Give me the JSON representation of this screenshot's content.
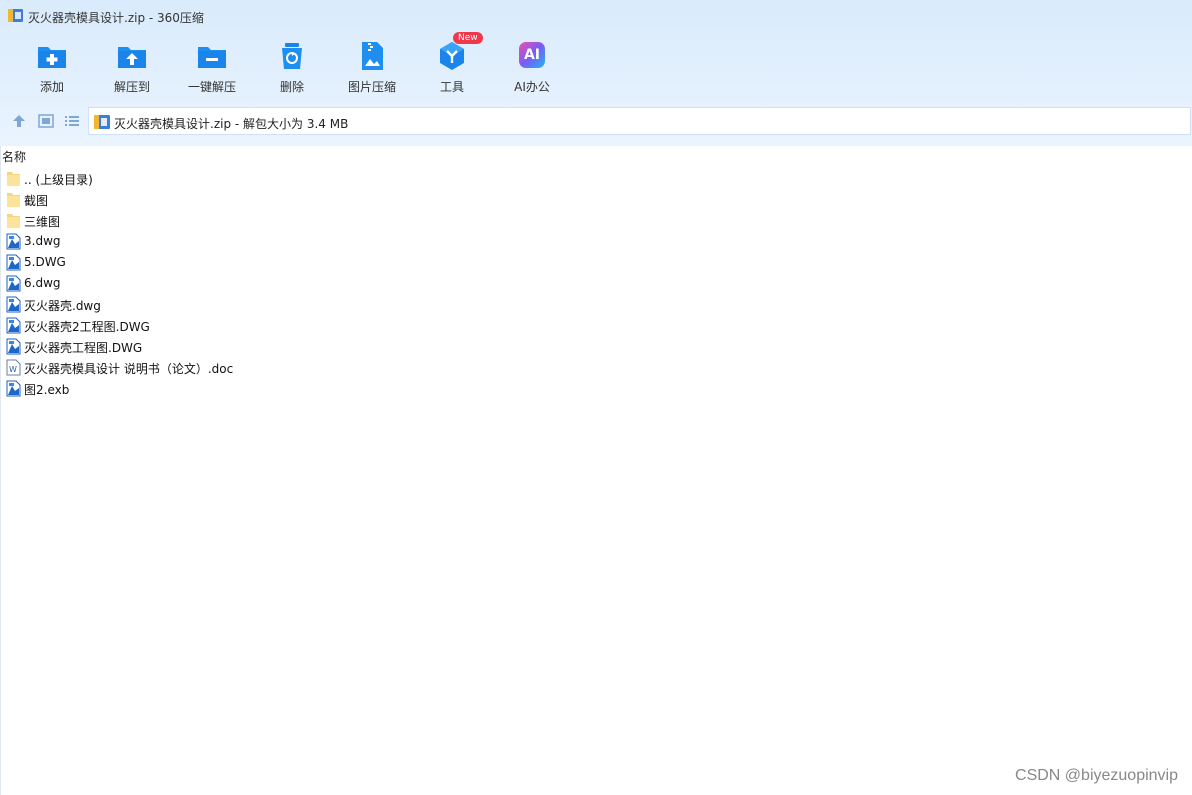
{
  "window": {
    "title": "灭火器壳模具设计.zip - 360压缩"
  },
  "toolbar": {
    "items": [
      {
        "label": "添加",
        "icon": "add-folder-icon"
      },
      {
        "label": "解压到",
        "icon": "extract-to-icon"
      },
      {
        "label": "一键解压",
        "icon": "one-click-extract-icon"
      },
      {
        "label": "删除",
        "icon": "recycle-bin-icon"
      },
      {
        "label": "图片压缩",
        "icon": "image-compress-icon"
      },
      {
        "label": "工具",
        "icon": "tools-icon",
        "badge": "New"
      },
      {
        "label": "AI办公",
        "icon": "ai-office-icon",
        "icon_text": "AI"
      }
    ]
  },
  "addressbar": {
    "text": "灭火器壳模具设计.zip - 解包大小为 3.4 MB"
  },
  "filelist": {
    "header": "名称",
    "items": [
      {
        "name": ".. (上级目录)",
        "icon": "folder-icon"
      },
      {
        "name": "截图",
        "icon": "folder-icon"
      },
      {
        "name": "三维图",
        "icon": "folder-icon"
      },
      {
        "name": "3.dwg",
        "icon": "cad-file-icon"
      },
      {
        "name": "5.DWG",
        "icon": "cad-file-icon"
      },
      {
        "name": "6.dwg",
        "icon": "cad-file-icon"
      },
      {
        "name": "灭火器壳.dwg",
        "icon": "cad-file-icon"
      },
      {
        "name": "灭火器壳2工程图.DWG",
        "icon": "cad-file-icon"
      },
      {
        "name": "灭火器壳工程图.DWG",
        "icon": "cad-file-icon"
      },
      {
        "name": "灭火器壳模具设计 说明书（论文）.doc",
        "icon": "word-file-icon"
      },
      {
        "name": "图2.exb",
        "icon": "cad-file-icon"
      }
    ]
  },
  "watermark": "CSDN @biyezuopinvip",
  "colors": {
    "accent": "#1a8cf0",
    "toolbar_bg": "#dcecfc",
    "badge": "#f0384a"
  }
}
